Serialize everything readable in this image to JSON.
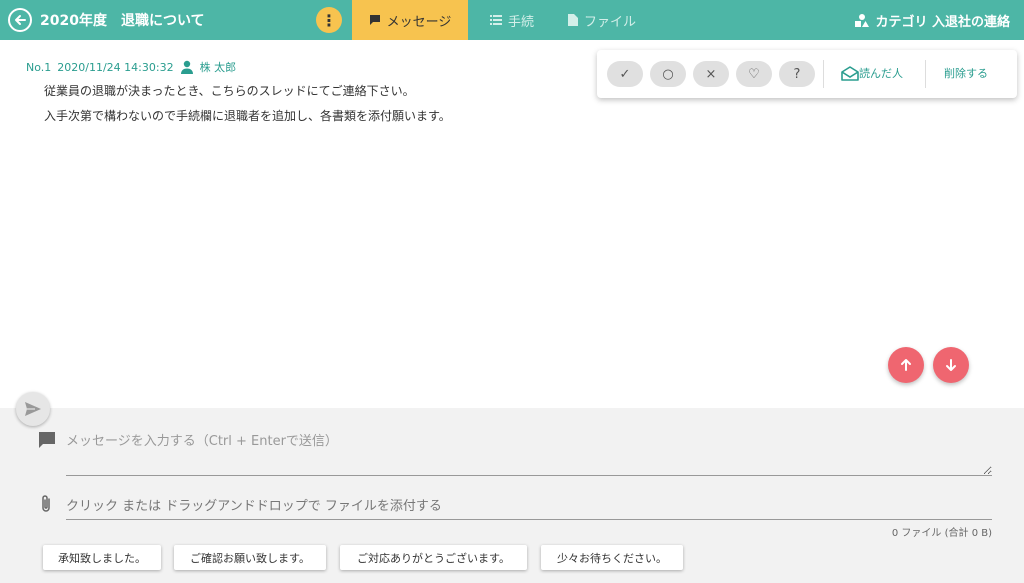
{
  "header": {
    "title": "2020年度　退職について",
    "menu_glyph": "⋮",
    "tabs": [
      {
        "label": "メッセージ"
      },
      {
        "label": "手続"
      },
      {
        "label": "ファイル"
      }
    ],
    "category": "カテゴリ 入退社の連絡"
  },
  "message": {
    "number": "No.1",
    "timestamp": "2020/11/24 14:30:32",
    "author": "株 太郎",
    "lines": [
      "従業員の退職が決まったとき、こちらのスレッドにてご連絡下さい。",
      "入手次第で構わないので手続欄に退職者を追加し、各書類を添付願います。"
    ]
  },
  "reactions": {
    "buttons": [
      "✓",
      "○",
      "×",
      "♡",
      "?"
    ],
    "readers_label": "読んだ人",
    "delete_label": "削除する"
  },
  "composer": {
    "placeholder": "メッセージを入力する（Ctrl + Enterで送信）",
    "file_drop": "クリック または ドラッグアンドドロップで ファイルを添付する",
    "file_count": "0 ファイル (合計 0 B)",
    "quick_replies": [
      "承知致しました。",
      "ご確認お願い致します。",
      "ご対応ありがとうございます。",
      "少々お待ちください。"
    ]
  },
  "colors": {
    "header_bg": "#4db6a6",
    "active_tab": "#f7c34f",
    "accent_text": "#2a9d8f",
    "fab": "#ef6670"
  },
  "icons": {
    "back": "arrow-left-circle-icon",
    "message_tab": "chat-bubble-icon",
    "procedure_tab": "list-icon",
    "files_tab": "file-icon",
    "category": "shapes-icon",
    "author": "person-icon",
    "readers": "envelope-open-icon",
    "scroll_up": "arrow-up-icon",
    "scroll_down": "arrow-down-icon",
    "send": "send-icon",
    "composer_message": "chat-icon",
    "attach": "paperclip-icon"
  }
}
